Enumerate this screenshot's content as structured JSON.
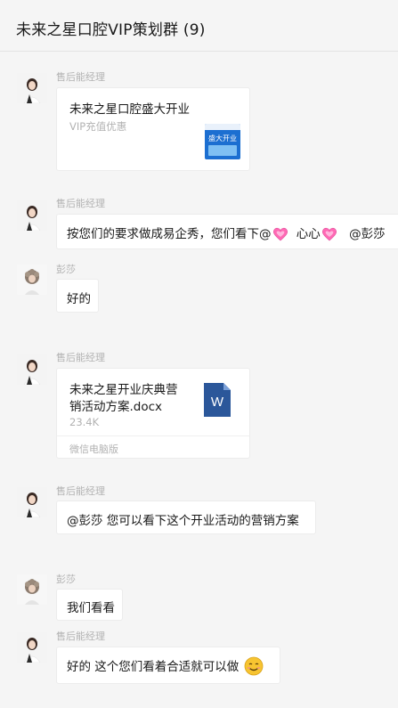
{
  "window": {
    "title": "未来之星口腔VIP策划群 (9)"
  },
  "messages": [
    {
      "sender": "售后能经理",
      "card_title": "未来之星口腔盛大开业",
      "card_sub": "VIP充值优惠",
      "thumb_text": "盛大开业"
    },
    {
      "sender": "售后能经理",
      "text_a": "按您们的要求做成易企秀，您们看下@",
      "text_b": "心心",
      "text_c": "@彭莎"
    },
    {
      "sender": "彭莎",
      "text": "好的"
    },
    {
      "sender": "售后能经理",
      "file_line1": "未来之星开业庆典营",
      "file_line2": "销活动方案.docx",
      "file_size": "23.4K",
      "file_source": "微信电脑版",
      "file_icon_letter": "W"
    },
    {
      "sender": "售后能经理",
      "text": "@彭莎 您可以看下这个开业活动的营销方案"
    },
    {
      "sender": "彭莎",
      "text": "我们看看"
    },
    {
      "sender": "售后能经理",
      "text": "好的 这个您们看着合适就可以做"
    }
  ],
  "colors": {
    "accent_word": "#2b579a",
    "heart": "#ff69b4",
    "smiley": "#f7c431"
  }
}
